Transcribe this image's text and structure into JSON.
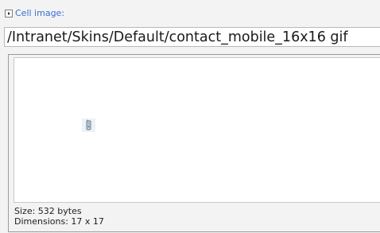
{
  "cell_image": {
    "label": "Cell image:",
    "path": "/Intranet/Skins/Default/contact_mobile_16x16 gif",
    "preview_icon": "mobile-phone-icon",
    "size_label": "Size:",
    "size_value": "532 bytes",
    "dimensions_label": "Dimensions:",
    "dimensions_value": "17 x 17"
  },
  "colors": {
    "label_blue": "#3a6fd8",
    "background": "#f3f3f3",
    "preview_bg": "#ffffff"
  }
}
